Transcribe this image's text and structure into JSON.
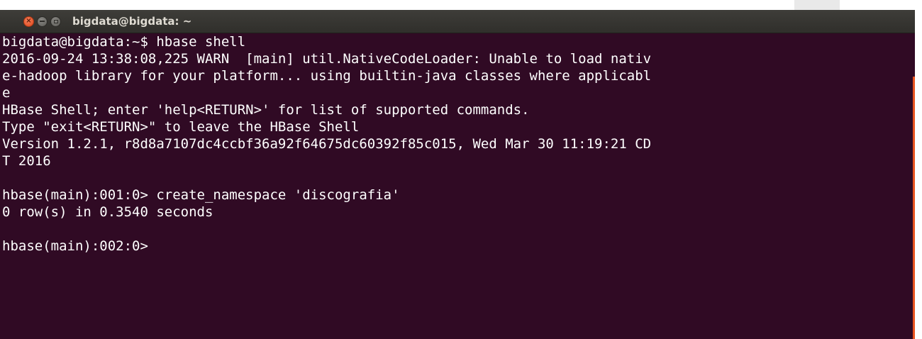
{
  "window": {
    "title": "bigdata@bigdata: ~",
    "buttons": {
      "close": "×",
      "minimize": "",
      "maximize": ""
    }
  },
  "terminal": {
    "lines": [
      "bigdata@bigdata:~$ hbase shell",
      "2016-09-24 13:38:08,225 WARN  [main] util.NativeCodeLoader: Unable to load nativ",
      "e-hadoop library for your platform... using builtin-java classes where applicabl",
      "e",
      "HBase Shell; enter 'help<RETURN>' for list of supported commands.",
      "Type \"exit<RETURN>\" to leave the HBase Shell",
      "Version 1.2.1, r8d8a7107dc4ccbf36a92f64675dc60392f85c015, Wed Mar 30 11:19:21 CD",
      "T 2016",
      "",
      "hbase(main):001:0> create_namespace 'discografia'",
      "0 row(s) in 0.3540 seconds",
      "",
      "hbase(main):002:0> "
    ]
  },
  "colors": {
    "background": "#300a24",
    "text": "#ffffff",
    "titlebar": "#3c3b37",
    "accent": "#e95420"
  }
}
